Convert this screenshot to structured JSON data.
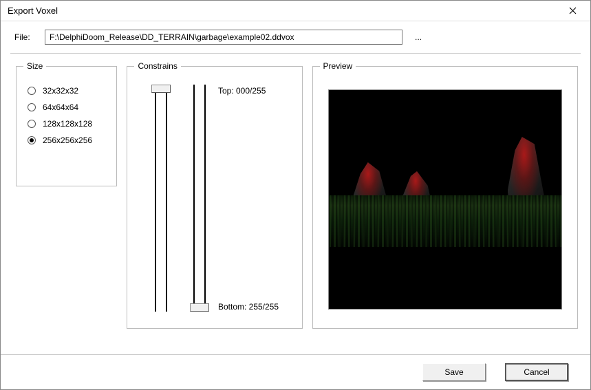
{
  "window": {
    "title": "Export Voxel"
  },
  "file": {
    "label": "File:",
    "path": "F:\\DelphiDoom_Release\\DD_TERRAIN\\garbage\\example02.ddvox",
    "browse": "..."
  },
  "size": {
    "legend": "Size",
    "options": [
      {
        "label": "32x32x32",
        "checked": false
      },
      {
        "label": "64x64x64",
        "checked": false
      },
      {
        "label": "128x128x128",
        "checked": false
      },
      {
        "label": "256x256x256",
        "checked": true
      }
    ]
  },
  "constrains": {
    "legend": "Constrains",
    "top_label": "Top: 000/255",
    "bottom_label": "Bottom: 255/255"
  },
  "preview": {
    "legend": "Preview"
  },
  "buttons": {
    "save": "Save",
    "cancel": "Cancel"
  }
}
